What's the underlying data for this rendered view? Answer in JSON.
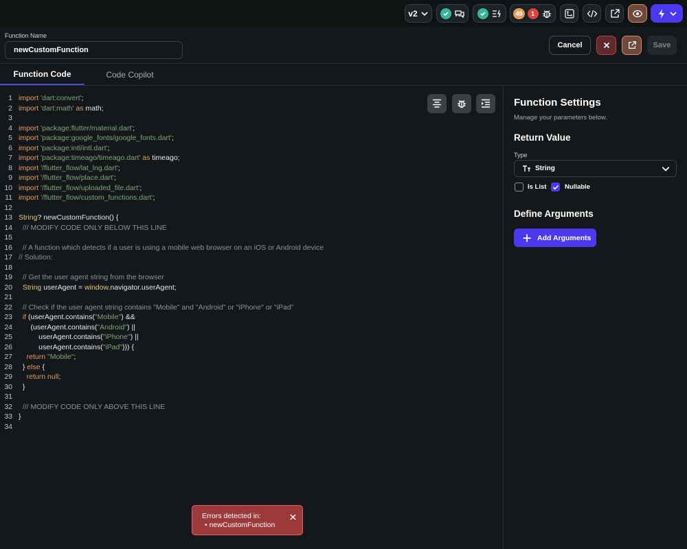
{
  "topbar": {
    "version": "v2",
    "warning_count": "49",
    "error_count": "1"
  },
  "header": {
    "function_name_label": "Function Name",
    "function_name_value": "newCustomFunction",
    "cancel_label": "Cancel",
    "save_label": "Save"
  },
  "tabs": [
    {
      "label": "Function Code",
      "active": true
    },
    {
      "label": "Code Copilot",
      "active": false
    }
  ],
  "code_lines": [
    {
      "n": "1",
      "html": "<span class='kw'>import</span> <span class='str'>'dart:convert'</span>;"
    },
    {
      "n": "2",
      "html": "<span class='kw'>import</span> <span class='str'>'dart:math'</span> <span class='kw'>as</span> math;"
    },
    {
      "n": "3",
      "html": ""
    },
    {
      "n": "4",
      "html": "<span class='kw'>import</span> <span class='str'>'package:flutter/material.dart'</span>;"
    },
    {
      "n": "5",
      "html": "<span class='kw'>import</span> <span class='str'>'package:google_fonts/google_fonts.dart'</span>;"
    },
    {
      "n": "6",
      "html": "<span class='kw'>import</span> <span class='str'>'package:intl/intl.dart'</span>;"
    },
    {
      "n": "7",
      "html": "<span class='kw'>import</span> <span class='str'>'package:timeago/timeago.dart'</span> <span class='kw'>as</span> timeago;"
    },
    {
      "n": "8",
      "html": "<span class='kw'>import</span> <span class='str'>'/flutter_flow/lat_lng.dart'</span>;"
    },
    {
      "n": "9",
      "html": "<span class='kw'>import</span> <span class='str'>'/flutter_flow/place.dart'</span>;"
    },
    {
      "n": "10",
      "html": "<span class='kw'>import</span> <span class='str'>'/flutter_flow/uploaded_file.dart'</span>;"
    },
    {
      "n": "11",
      "html": "<span class='kw'>import</span> <span class='str'>'/flutter_flow/custom_functions.dart'</span>;"
    },
    {
      "n": "12",
      "html": ""
    },
    {
      "n": "13",
      "html": "<span class='ty'>String</span>? newCustomFunction() {"
    },
    {
      "n": "14",
      "html": "  <span class='cm'>/// MODIFY CODE ONLY BELOW THIS LINE</span>"
    },
    {
      "n": "15",
      "html": ""
    },
    {
      "n": "16",
      "html": "  <span class='cm'>// A function which detects if a user is using a mobile web browser on an iOS or Android device</span>"
    },
    {
      "n": "17",
      "html": "<span class='cm'>// Solution:</span>"
    },
    {
      "n": "18",
      "html": ""
    },
    {
      "n": "19",
      "html": "  <span class='cm'>// Get the user agent string from the browser</span>"
    },
    {
      "n": "20",
      "html": "  <span class='ty'>String</span> userAgent = <span class='ty'>window</span>.navigator.userAgent;"
    },
    {
      "n": "21",
      "html": ""
    },
    {
      "n": "22",
      "html": "  <span class='cm'>// Check if the user agent string contains \"Mobile\" and \"Android\" or \"iPhone\" or \"iPad\"</span>"
    },
    {
      "n": "23",
      "html": "  <span class='kw'>if</span> (userAgent.contains(<span class='str'>\"Mobile\"</span>) &amp;&amp;"
    },
    {
      "n": "24",
      "html": "      (userAgent.contains(<span class='str'>\"Android\"</span>) ||"
    },
    {
      "n": "25",
      "html": "          userAgent.contains(<span class='str'>\"iPhone\"</span>) ||"
    },
    {
      "n": "26",
      "html": "          userAgent.contains(<span class='str'>\"iPad\"</span>))) {"
    },
    {
      "n": "27",
      "html": "    <span class='kw'>return</span> <span class='str'>\"Mobile\"</span>;"
    },
    {
      "n": "28",
      "html": "  } <span class='kw'>else</span> {"
    },
    {
      "n": "29",
      "html": "    <span class='kw'>return null</span>;"
    },
    {
      "n": "30",
      "html": "  }"
    },
    {
      "n": "31",
      "html": ""
    },
    {
      "n": "32",
      "html": "  <span class='cm'>/// MODIFY CODE ONLY ABOVE THIS LINE</span>"
    },
    {
      "n": "33",
      "html": "}"
    },
    {
      "n": "34",
      "html": ""
    }
  ],
  "toast": {
    "title": "Errors detected in:",
    "item": "• newCustomFunction"
  },
  "settings": {
    "title": "Function Settings",
    "subtitle": "Manage your parameters below.",
    "return_value_heading": "Return Value",
    "type_label": "Type",
    "type_value": "String",
    "is_list_label": "Is List",
    "is_list_checked": false,
    "nullable_label": "Nullable",
    "nullable_checked": true,
    "define_args_heading": "Define Arguments",
    "add_args_label": "Add Arguments"
  },
  "colors": {
    "accent": "#4b39ef",
    "error": "#9c3a3b",
    "success": "#38b69c",
    "warning": "#e29e5e"
  }
}
